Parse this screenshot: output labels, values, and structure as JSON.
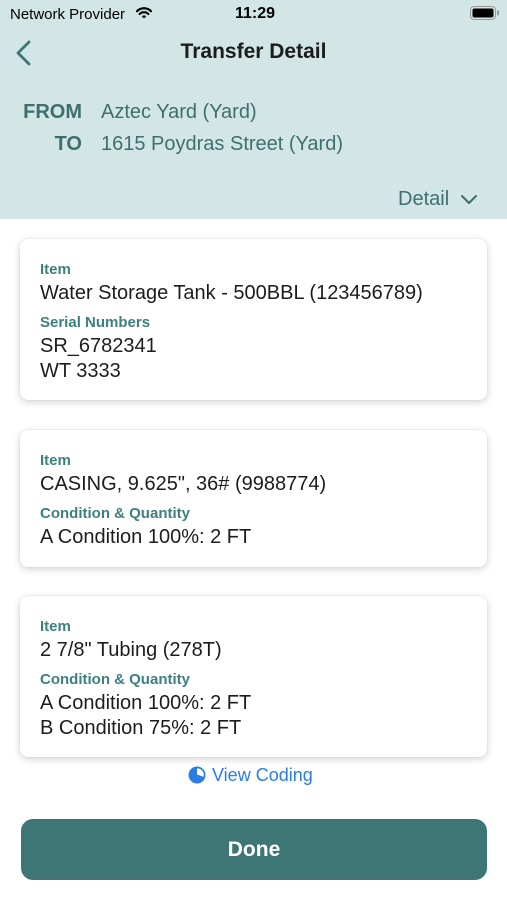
{
  "status_bar": {
    "carrier": "Network Provider",
    "time": "11:29"
  },
  "nav": {
    "title": "Transfer Detail",
    "back_icon": "chevron-left-icon"
  },
  "route": {
    "from_label": "FROM",
    "from_value": "Aztec Yard (Yard)",
    "to_label": "TO",
    "to_value": "1615 Poydras Street (Yard)"
  },
  "detail_toggle": {
    "label": "Detail",
    "icon": "chevron-down-icon"
  },
  "cards": [
    {
      "item_label": "Item",
      "item_value": "Water Storage Tank - 500BBL (123456789)",
      "secondary_label": "Serial Numbers",
      "secondary_lines": [
        "SR_6782341",
        "WT 3333"
      ]
    },
    {
      "item_label": "Item",
      "item_value": "CASING, 9.625\", 36# (9988774)",
      "secondary_label": "Condition & Quantity",
      "secondary_lines": [
        "A Condition 100%: 2 FT"
      ]
    },
    {
      "item_label": "Item",
      "item_value": "2 7/8\" Tubing (278T)",
      "secondary_label": "Condition & Quantity",
      "secondary_lines": [
        "A Condition 100%: 2 FT",
        "B Condition 75%: 2 FT"
      ]
    }
  ],
  "view_coding": {
    "label": "View Coding",
    "icon": "pie-chart-icon"
  },
  "done_button": {
    "label": "Done"
  },
  "colors": {
    "header_bg": "#d3e6e6",
    "accent": "#3e7575",
    "label_teal": "#3e7f7f",
    "link_blue": "#2a7de1"
  }
}
